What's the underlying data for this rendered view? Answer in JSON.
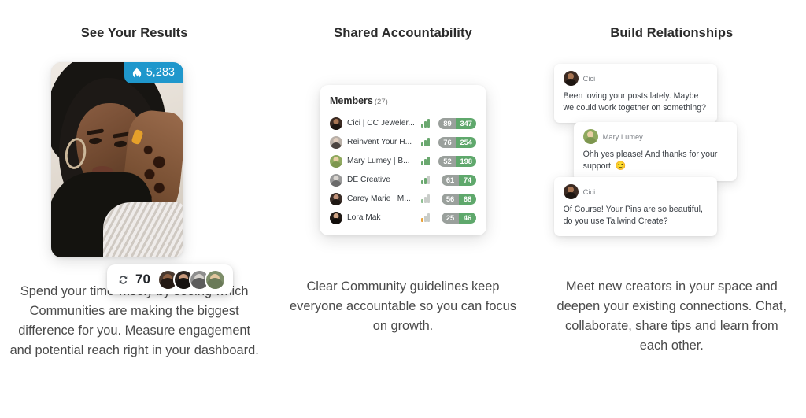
{
  "columns": [
    {
      "title": "See Your Results",
      "body": "Spend your time wisely by seeing which Communities are making the biggest difference for you. Measure engagement and potential reach right in your dashboard.",
      "card": {
        "fire_badge": {
          "icon": "flame-icon",
          "value": "5,283",
          "color": "#1f97cc"
        },
        "repin_pill": {
          "icon": "repin-icon",
          "value": "70",
          "avatar_count": 4
        }
      }
    },
    {
      "title": "Shared Accountability",
      "body": "Clear Community guidelines keep everyone accountable so you can focus on growth.",
      "members_panel": {
        "header_label": "Members",
        "header_count": "(27)",
        "rows": [
          {
            "name": "Cici | CC Jeweler...",
            "bars_filled": 3,
            "bar_color": "#6aa86f",
            "left": "89",
            "right": "347"
          },
          {
            "name": "Reinvent Your H...",
            "bars_filled": 3,
            "bar_color": "#6aa86f",
            "left": "76",
            "right": "254"
          },
          {
            "name": "Mary Lumey | B...",
            "bars_filled": 3,
            "bar_color": "#6aa86f",
            "left": "52",
            "right": "198"
          },
          {
            "name": "DE Creative",
            "bars_filled": 2,
            "bar_color": "#6aa86f",
            "left": "61",
            "right": "74"
          },
          {
            "name": "Carey Marie | M...",
            "bars_filled": 1,
            "bar_color": "#8fbf92",
            "left": "56",
            "right": "68"
          },
          {
            "name": "Lora Mak",
            "bars_filled": 1,
            "bar_color": "#e8a33c",
            "left": "25",
            "right": "46"
          }
        ]
      }
    },
    {
      "title": "Build Relationships",
      "body": "Meet new creators in your space and deepen your existing connections. Chat, collaborate, share tips and learn from each other.",
      "chat": {
        "messages": [
          {
            "author": "Cici",
            "text": "Been loving your posts lately. Maybe we could work together on something?",
            "emoji": ""
          },
          {
            "author": "Mary Lumey",
            "text": "Ohh yes please! And thanks for your support!",
            "emoji": "🙂"
          },
          {
            "author": "Cici",
            "text": "Of Course! Your Pins are so beautiful, do you use Tailwind Create?",
            "emoji": ""
          }
        ]
      }
    }
  ],
  "colors": {
    "page_background": "#ffffff",
    "title": "#2b2b2b",
    "body_text": "#4a4a4a",
    "badge_blue": "#1f97cc",
    "pill_gray": "#9aa09c",
    "pill_green": "#5fa86c"
  }
}
